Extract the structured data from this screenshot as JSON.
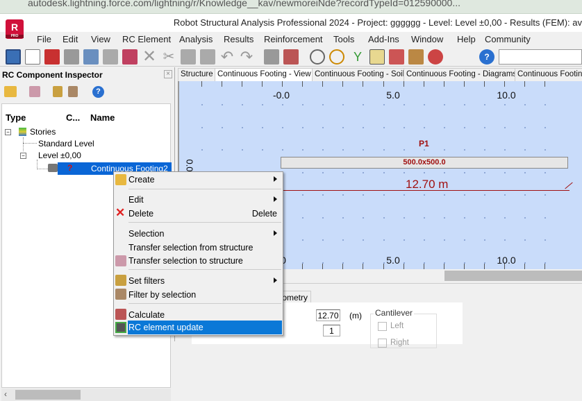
{
  "browser": {
    "url": "autodesk.lightning.force.com/lightning/r/Knowledge__kav/newmoreiNde?recordTypeId=012590000..."
  },
  "window": {
    "title": "Robot Structural Analysis Professional 2024 - Project: gggggg - Level: Level ±0,00 - Results (FEM): av",
    "logo": "R",
    "logo_sub": "PRO"
  },
  "menu": [
    "File",
    "Edit",
    "View",
    "RC Element",
    "Analysis",
    "Results",
    "Reinforcement",
    "Tools",
    "Add-Ins",
    "Window",
    "Help",
    "Community"
  ],
  "inspector": {
    "title": "RC Component Inspector",
    "close": "×",
    "columns": {
      "type": "Type",
      "c": "C...",
      "name": "Name"
    },
    "tree": {
      "stories": "Stories",
      "standard": "Standard Level",
      "level": "Level ±0,00",
      "status": "?",
      "footing": "Continuous Footing2"
    }
  },
  "tabs": [
    "Structure",
    "Continuous Footing - View",
    "Continuous Footing - Soil",
    "Continuous Footing - Diagrams",
    "Continuous Footing"
  ],
  "view": {
    "x_ticks": [
      "-0.0",
      "5.0",
      "10.0"
    ],
    "x_ticks_bottom": [
      "0",
      "5.0",
      "10.0"
    ],
    "y_label": "0.0",
    "support": "P1",
    "section": "500.0x500.0",
    "length": "12.70 m",
    "colors": {
      "canvas": "#c9dcfa",
      "annotation": "#a01010"
    }
  },
  "bottom": {
    "tab": "Geometry",
    "length_value": "12.70",
    "length_unit": "(m)",
    "count_value": "1",
    "cantilever": "Cantilever",
    "left": "Left",
    "right": "Right"
  },
  "context_menu": {
    "create": "Create",
    "edit": "Edit",
    "delete": "Delete",
    "delete_shortcut": "Delete",
    "selection": "Selection",
    "transfer_from": "Transfer selection from structure",
    "transfer_to": "Transfer selection to structure",
    "set_filters": "Set filters",
    "filter_by": "Filter by selection",
    "calculate": "Calculate",
    "rc_update": "RC element update"
  }
}
